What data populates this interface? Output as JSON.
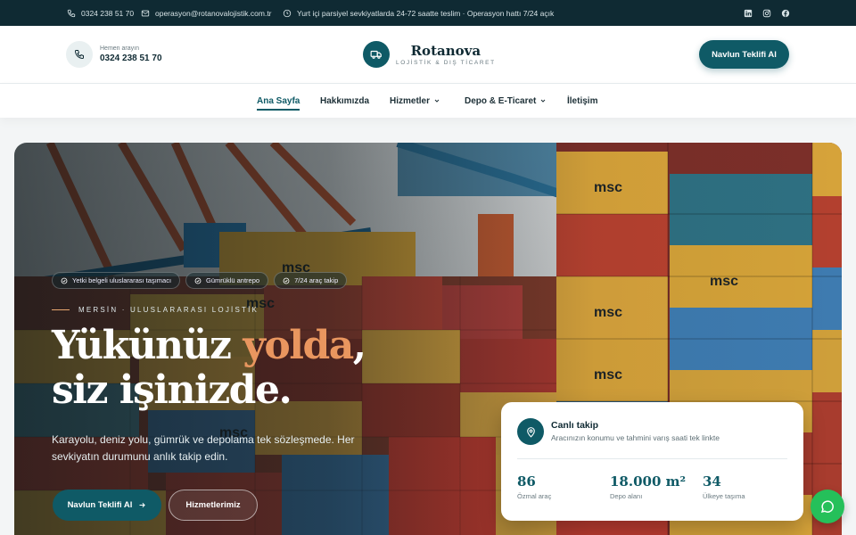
{
  "topbar": {
    "phone": "0324 238 51 70",
    "email": "operasyon@rotanovalojistik.com.tr",
    "notice": "Yurt içi parsiyel sevkiyatlarda 24-72 saatte teslim · Operasyon hattı 7/24 açık",
    "social": [
      "linkedin-icon",
      "instagram-icon",
      "facebook-icon"
    ]
  },
  "header": {
    "call_label": "Hemen arayın",
    "call_number": "0324 238 51 70",
    "brand_name": "Rotanova",
    "brand_tagline": "LOJİSTİK & DIŞ TİCARET",
    "cta_label": "Navlun Teklifi Al"
  },
  "nav": {
    "items": [
      {
        "label": "Ana Sayfa",
        "active": true,
        "dropdown": false
      },
      {
        "label": "Hakkımızda",
        "active": false,
        "dropdown": false
      },
      {
        "label": "Hizmetler",
        "active": false,
        "dropdown": true
      },
      {
        "label": "Depo & E-Ticaret",
        "active": false,
        "dropdown": true
      },
      {
        "label": "İletişim",
        "active": false,
        "dropdown": false
      }
    ]
  },
  "hero": {
    "badges": [
      "Yetki belgeli uluslararası taşımacı",
      "Gümrüklü antrepo",
      "7/24 araç takip"
    ],
    "eyebrow": "MERSİN · ULUSLARARASI LOJİSTİK",
    "title_part1": "Yükünüz",
    "title_accent": "yolda",
    "title_comma": ",",
    "title_line2": "siz işinizde.",
    "lead": "Karayolu, deniz yolu, gümrük ve depolama tek sözleşmede. Her sevkiyatın durumunu anlık takip edin.",
    "primary_button": "Navlun Teklifi Al",
    "secondary_button": "Hizmetlerimiz"
  },
  "tracking": {
    "title": "Canlı takip",
    "subtitle": "Aracınızın konumu ve tahmini varış saati tek linkte",
    "stats": [
      {
        "value": "86",
        "label": "Özmal araç"
      },
      {
        "value": "18.000 m²",
        "label": "Depo alanı"
      },
      {
        "value": "34",
        "label": "Ülkeye taşıma"
      }
    ]
  },
  "colors": {
    "primary": "#0f5a66",
    "topbar": "#0f2a33",
    "accent": "#e9965f",
    "whatsapp": "#25c05a"
  }
}
